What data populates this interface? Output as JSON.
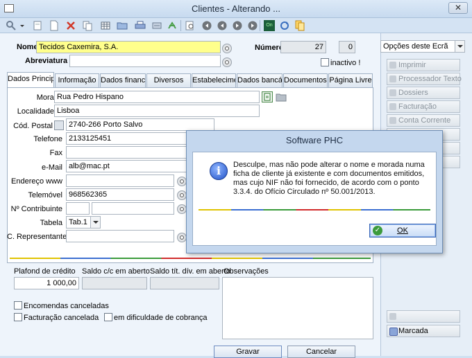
{
  "window": {
    "title": "Clientes - Alterando ...",
    "close_glyph": "✕"
  },
  "toolbar": {
    "icons": [
      "search-icon",
      "new-doc-icon",
      "delete-icon",
      "copy-icon",
      "grid-icon",
      "folder-icon",
      "print-icon",
      "filter-icon",
      "refresh-icon",
      "preview-icon",
      "first-record-icon",
      "prev-record-icon",
      "next-record-icon",
      "last-record-icon",
      "online-icon",
      "sync-icon",
      "documents-icon"
    ],
    "online_label": "On"
  },
  "form": {
    "nome_label": "Nome",
    "nome_value": "Tecidos Caxemira, S.A.",
    "abreviatura_label": "Abreviatura",
    "abreviatura_value": "",
    "numero_label": "Número",
    "numero_value": "27",
    "numero_sub_value": "0",
    "inactivo_label": "inactivo !",
    "opcoes_label": "Opções deste Ecrã"
  },
  "tabs": [
    {
      "label": "Dados Principais"
    },
    {
      "label": "Informação"
    },
    {
      "label": "Dados financeiros"
    },
    {
      "label": "Diversos"
    },
    {
      "label": "Estabelecimentos"
    },
    {
      "label": "Dados bancários"
    },
    {
      "label": "Documentos de"
    },
    {
      "label": "Página Livre"
    }
  ],
  "fields": {
    "morada_label": "Morada",
    "morada_value": "Rua Pedro Hispano",
    "localidade_label": "Localidade",
    "localidade_value": "Lisboa",
    "cod_postal_label": "Cód. Postal",
    "cod_postal_value": "2740-266 Porto Salvo",
    "telefone_label": "Telefone",
    "telefone_value": "2133125451",
    "fax_label": "Fax",
    "fax_value": "",
    "email_label": "e-Mail",
    "email_value": "alb@mac.pt",
    "endereco_label": "Endereço www",
    "endereco_value": "",
    "telemovel_label": "Telemóvel",
    "telemovel_value": "968562365",
    "contribuinte_label": "Nº Contribuinte",
    "contribuinte_value": "",
    "tabela_label": "Tabela",
    "tabela_value": "Tab.1",
    "representante_label": "C. Representante",
    "representante_value": ""
  },
  "financial": {
    "plafond_label": "Plafond de crédito",
    "plafond_value": "1 000,00",
    "saldo_label": "Saldo c/c em aberto",
    "saldo_value": "",
    "saldo_tit_label": "Saldo tít. dív. em aberto",
    "saldo_tit_value": "",
    "observacoes_label": "Observações"
  },
  "checks": {
    "encomendas": "Encomendas canceladas",
    "facturacao": "Facturação cancelada",
    "dificuldade": "em dificuldade de cobrança"
  },
  "right_panel": {
    "buttons": [
      {
        "label": "Imprimir"
      },
      {
        "label": "Processador Texto"
      },
      {
        "label": "Dossiers"
      },
      {
        "label": "Facturação"
      },
      {
        "label": "Conta Corrente"
      }
    ],
    "marcada": "Marcada"
  },
  "bottom": {
    "gravar": "Gravar",
    "cancelar": "Cancelar"
  },
  "dialog": {
    "title": "Software PHC",
    "message": "Desculpe, mas não pode alterar o nome e morada numa ficha de cliente já existente e com documentos emitidos, mas cujo NIF não foi fornecido, de acordo com o ponto 3.3.4. do Ofício Circulado nº 50.001/2013.",
    "ok": "OK",
    "info_glyph": "i",
    "ok_glyph": "✓"
  }
}
